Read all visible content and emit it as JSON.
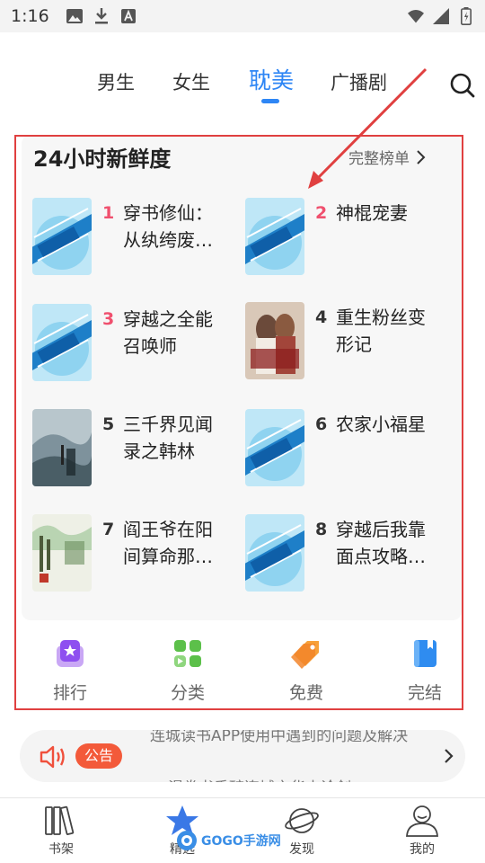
{
  "status_bar": {
    "time": "1:16",
    "left_icons": [
      "image-icon",
      "download-icon",
      "a-box-icon"
    ],
    "right_icons": [
      "wifi-icon",
      "signal-icon",
      "battery-icon"
    ]
  },
  "top_tabs": {
    "tabs": [
      {
        "label": "男生",
        "active": false
      },
      {
        "label": "女生",
        "active": false
      },
      {
        "label": "耽美",
        "active": true
      },
      {
        "label": "广播剧",
        "active": false
      }
    ],
    "search_icon": "search-icon",
    "active_color": "#2e86f5"
  },
  "ranking": {
    "title": "24小时新鲜度",
    "more_label": "完整榜单",
    "books": [
      {
        "rank": "1",
        "title": "穿书修仙：从纨绔废…",
        "cover": "blue-series"
      },
      {
        "rank": "2",
        "title": "神棍宠妻",
        "cover": "blue-series"
      },
      {
        "rank": "3",
        "title": "穿越之全能召唤师",
        "cover": "blue-series"
      },
      {
        "rank": "4",
        "title": "重生粉丝变形记",
        "cover": "illustrated"
      },
      {
        "rank": "5",
        "title": "三千界见闻录之韩林",
        "cover": "misty-landscape"
      },
      {
        "rank": "6",
        "title": "农家小福星",
        "cover": "blue-series"
      },
      {
        "rank": "7",
        "title": "阎王爷在阳间算命那…",
        "cover": "ink-painting"
      },
      {
        "rank": "8",
        "title": "穿越后我靠面点攻略…",
        "cover": "blue-series"
      }
    ],
    "top_rank_color": "#f0506e"
  },
  "quick_nav": [
    {
      "label": "排行",
      "icon": "star-box-icon"
    },
    {
      "label": "分类",
      "icon": "grid-icon"
    },
    {
      "label": "免费",
      "icon": "tag-icon"
    },
    {
      "label": "完结",
      "icon": "book-icon"
    }
  ],
  "notice": {
    "badge": "公告",
    "line_top": "连城读书APP使用中遇到的问题及解决",
    "line_bottom": "漫卷书香醉连城之华山论剑"
  },
  "bottom_nav": [
    {
      "label": "书架",
      "icon": "bookshelf-icon"
    },
    {
      "label": "精选",
      "icon": "star-icon"
    },
    {
      "label": "发现",
      "icon": "planet-icon"
    },
    {
      "label": "我的",
      "icon": "profile-icon"
    }
  ],
  "watermark": "GOGO手游网",
  "annotation_color": "#e04040"
}
